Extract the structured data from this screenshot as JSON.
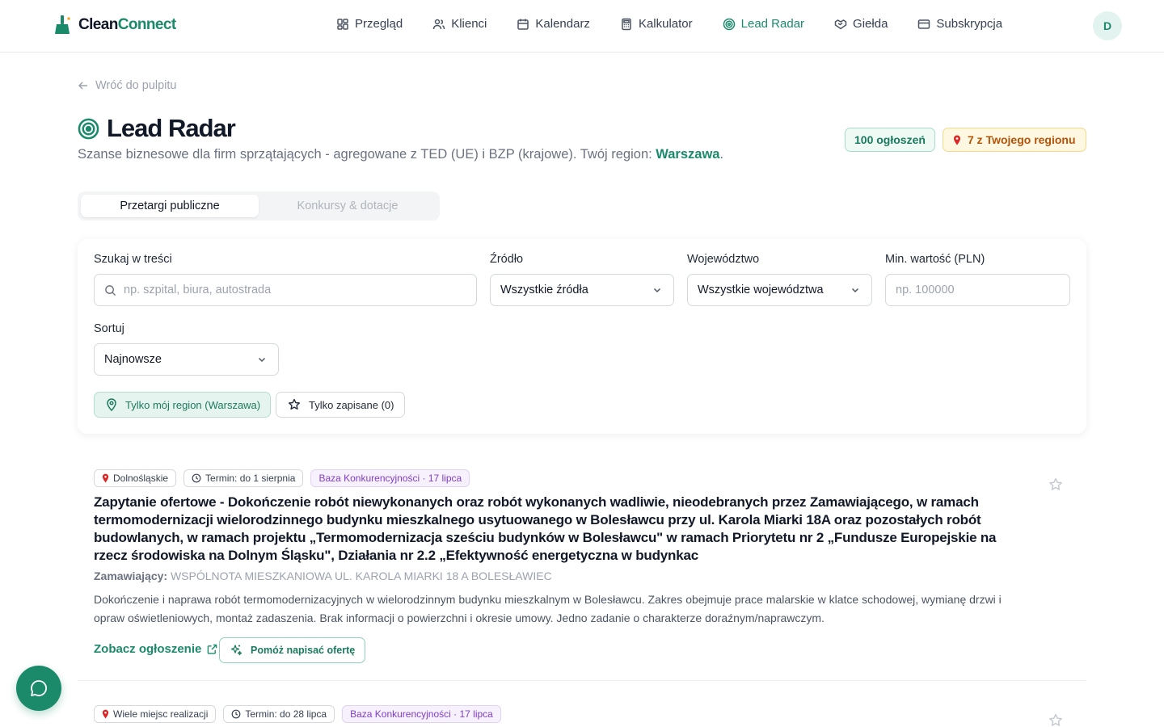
{
  "brand": {
    "name_part1": "Clean",
    "name_part2": "Connect"
  },
  "nav": {
    "items": [
      {
        "label": "Przegląd",
        "icon": "dashboard-icon"
      },
      {
        "label": "Klienci",
        "icon": "users-icon"
      },
      {
        "label": "Kalendarz",
        "icon": "calendar-icon"
      },
      {
        "label": "Kalkulator",
        "icon": "calculator-icon"
      },
      {
        "label": "Lead Radar",
        "icon": "radar-icon",
        "active": true
      },
      {
        "label": "Giełda",
        "icon": "handshake-icon"
      },
      {
        "label": "Subskrypcja",
        "icon": "credit-card-icon"
      }
    ],
    "avatar_initial": "D"
  },
  "header": {
    "back_label": "Wróć do pulpitu",
    "title": "Lead Radar",
    "subtitle_prefix": "Szanse biznesowe dla firm sprzątających - agregowane z TED (UE) i BZP (krajowe). Twój region: ",
    "region": "Warszawa",
    "subtitle_suffix": ".",
    "count_badge": "100 ogłoszeń",
    "region_badge": "7 z Twojego regionu"
  },
  "tabs": [
    {
      "label": "Przetargi publiczne",
      "active": true
    },
    {
      "label": "Konkursy & dotacje",
      "active": false
    }
  ],
  "filters": {
    "search_label": "Szukaj w treści",
    "search_placeholder": "np. szpital, biura, autostrada",
    "source_label": "Źródło",
    "source_value": "Wszystkie źródła",
    "voivodeship_label": "Województwo",
    "voivodeship_value": "Wszystkie województwa",
    "min_value_label": "Min. wartość (PLN)",
    "min_value_placeholder": "np. 100000",
    "sort_label": "Sortuj",
    "sort_value": "Najnowsze",
    "chip_region": "Tylko mój region (Warszawa)",
    "chip_saved": "Tylko zapisane (0)"
  },
  "leads": [
    {
      "location": "Dolnośląskie",
      "deadline": "Termin: do 1 sierpnia",
      "source": "Baza Konkurencyjności · 17 lipca",
      "title": "Zapytanie ofertowe - Dokończenie robót niewykonanych oraz robót wykonanych wadliwie, nieodebranych przez Zamawiającego, w ramach termomodernizacji wielorodzinnego budynku mieszkalnego usytuowanego w Bolesławcu przy ul. Karola Miarki 18A oraz pozostałych robót budowlanych, w ramach projektu „Termomodernizacja sześciu budynków w Bolesławcu\" w ramach Priorytetu nr 2 „Fundusze Europejskie na rzecz środowiska na Dolnym Śląsku\", Działania nr 2.2 „Efektywność energetyczna w budynkac",
      "buyer_label": "Zamawiający:",
      "buyer": "WSPÓLNOTA MIESZKANIOWA UL. KAROLA MIARKI 18 A BOLESŁAWIEC",
      "description": "Dokończenie i naprawa robót termomodernizacyjnych w wielorodzinnym budynku mieszkalnym w Bolesławcu. Zakres obejmuje prace malarskie w klatce schodowej, wymianę drzwi i opraw oświetleniowych, montaż zadaszenia. Brak informacji o powierzchni i okresie umowy. Jedno zadanie o charakterze doraźnym/naprawczym.",
      "link_label": "Zobacz ogłoszenie",
      "help_label": "Pomóż napisać ofertę"
    },
    {
      "location": "Wiele miejsc realizacji",
      "deadline": "Termin: do 28 lipca",
      "source": "Baza Konkurencyjności · 17 lipca"
    }
  ],
  "colors": {
    "accent": "#1b8a6b",
    "source_tag": "#7e3fc9",
    "region_badge": "#b45309"
  }
}
